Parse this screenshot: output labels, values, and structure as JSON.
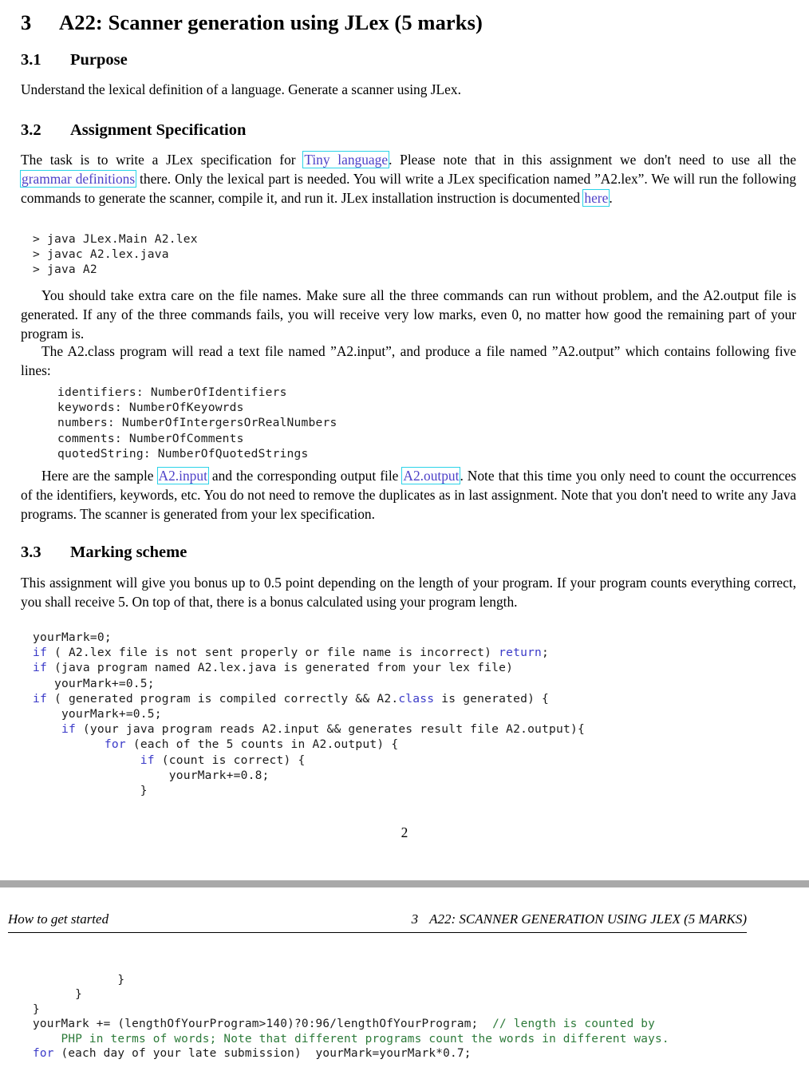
{
  "document": {
    "page1": {
      "section": {
        "number": "3",
        "title": "A22: Scanner generation using JLex (5 marks)"
      },
      "subsections": [
        {
          "number": "3.1",
          "title": "Purpose"
        },
        {
          "number": "3.2",
          "title": "Assignment Specification"
        },
        {
          "number": "3.3",
          "title": "Marking scheme"
        }
      ],
      "purpose_text": "Understand the lexical definition of a language. Generate a scanner using JLex.",
      "spec_para": {
        "t1": "The task is to write a JLex specification for ",
        "link1": "Tiny language",
        "t2": ". Please note that in this assignment we don't need to use all the ",
        "link2": "grammar definitions",
        "t3": " there. Only the lexical part is needed. You will write a JLex specification named ”A2.lex”. We will run the following commands to generate the scanner, compile it, and run it. JLex installation instruction is documented ",
        "link3": "here",
        "t4": "."
      },
      "commands_code": "> java JLex.Main A2.lex\n> javac A2.lex.java\n> java A2",
      "para_care": "You should take extra care on the file names. Make sure all the three commands can run without problem, and the A2.output file is generated. If any of the three commands fails, you will receive very low marks, even 0, no matter how good the remaining part of your program is.",
      "para_class": "The A2.class program will read a text file named ”A2.input”, and produce a file named ”A2.output” which contains following five lines:",
      "output_lines_code": "identifiers: NumberOfIdentifiers\nkeywords: NumberOfKeyowrds\nnumbers: NumberOfIntergersOrRealNumbers\ncomments: NumberOfComments\nquotedString: NumberOfQuotedStrings",
      "para_sample": {
        "t1": "Here are the sample ",
        "link1": "A2.input",
        "t2": " and the corresponding output file ",
        "link2": "A2.output",
        "t3": ". Note that this time you only need to count the occurrences of the identifiers, keywords, etc. You do not need to remove the duplicates as in last assignment. Note that you don't need to write any Java programs. The scanner is generated from your lex specification."
      },
      "para_marking": "This assignment will give you bonus up to 0.5 point depending on the length of your program. If your program counts everything correct, you shall receive 5. On top of that, there is a bonus calculated using your program length.",
      "marking_code_lines": [
        [
          {
            "text": "yourMark=0;",
            "cls": "plain"
          }
        ],
        [
          {
            "text": "if",
            "cls": "kw"
          },
          {
            "text": " ( A2.lex file is not sent properly or file name is incorrect) ",
            "cls": "plain"
          },
          {
            "text": "return",
            "cls": "kw"
          },
          {
            "text": ";",
            "cls": "plain"
          }
        ],
        [
          {
            "text": "if",
            "cls": "kw"
          },
          {
            "text": " (java program named A2.lex.java is generated from your lex file)",
            "cls": "plain"
          }
        ],
        [
          {
            "text": "   yourMark+=0.5;",
            "cls": "plain"
          }
        ],
        [
          {
            "text": "if",
            "cls": "kw"
          },
          {
            "text": " ( generated program is compiled correctly && A2.",
            "cls": "plain"
          },
          {
            "text": "class",
            "cls": "kw"
          },
          {
            "text": " is generated) {",
            "cls": "plain"
          }
        ],
        [
          {
            "text": "    yourMark+=0.5;",
            "cls": "plain"
          }
        ],
        [
          {
            "text": "    ",
            "cls": "plain"
          },
          {
            "text": "if",
            "cls": "kw"
          },
          {
            "text": " (your java program reads A2.input && generates result file A2.output){",
            "cls": "plain"
          }
        ],
        [
          {
            "text": "          ",
            "cls": "plain"
          },
          {
            "text": "for",
            "cls": "kw"
          },
          {
            "text": " (each of the 5 counts in A2.output) {",
            "cls": "plain"
          }
        ],
        [
          {
            "text": "               ",
            "cls": "plain"
          },
          {
            "text": "if",
            "cls": "kw"
          },
          {
            "text": " (count is correct) {",
            "cls": "plain"
          }
        ],
        [
          {
            "text": "                   yourMark+=0.8;",
            "cls": "plain"
          }
        ],
        [
          {
            "text": "               }",
            "cls": "plain"
          }
        ]
      ],
      "page_number": "2"
    },
    "page2": {
      "running_head": {
        "left": "How to get started",
        "right_number": "3",
        "right_title": "A22: SCANNER GENERATION USING JLEX (5 MARKS)"
      },
      "code_lines": [
        [
          {
            "text": "            }",
            "cls": "plain"
          }
        ],
        [
          {
            "text": "      }",
            "cls": "plain"
          }
        ],
        [
          {
            "text": "}",
            "cls": "plain"
          }
        ],
        [
          {
            "text": "yourMark += (lengthOfYourProgram>140)?0:96/lengthOfYourProgram;  ",
            "cls": "plain"
          },
          {
            "text": "// length is counted by",
            "cls": "cmt"
          }
        ],
        [
          {
            "text": "    ",
            "cls": "plain"
          },
          {
            "text": "PHP in terms of words; Note that different programs count the words in different ways.",
            "cls": "cmt"
          }
        ],
        [
          {
            "text": "for",
            "cls": "kw"
          },
          {
            "text": " (each day of your late submission)  yourMark=yourMark*0.7;",
            "cls": "plain"
          }
        ]
      ]
    }
  },
  "colors": {
    "link_text": "#4d41c8",
    "link_border": "#2ad3e8",
    "keyword": "#3a3ac8",
    "comment": "#2c7a39",
    "page_break_bar": "#a9a9a9"
  }
}
